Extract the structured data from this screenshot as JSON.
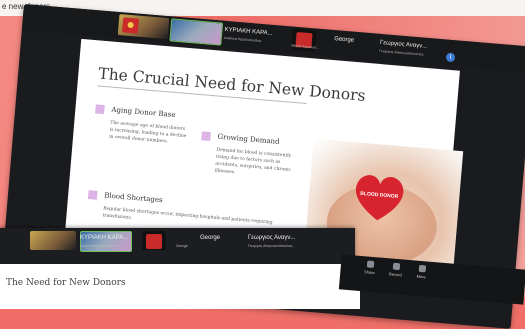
{
  "page_top_text": "e new donors.",
  "zoom": {
    "tiles": [
      {
        "name": "ΚΥΡΙΑΚΗ ΚΑΡΑ...",
        "sub": "Ιωνάννα Καραλοπούλου"
      },
      {
        "name": "George",
        "sub": "Μαρία Καραλοπ..."
      },
      {
        "name": "Γεωργιος Αναγν...",
        "sub": "Γεωργιος Αναγνωστόπουλος"
      }
    ],
    "info_icon": "i"
  },
  "slide": {
    "title": "The Crucial Need for New Donors",
    "sections": [
      {
        "heading": "Aging Donor Base",
        "body": "The average age of blood donors is increasing, leading to a decline in overall donor numbers."
      },
      {
        "heading": "Growing Demand",
        "body": "Demand for blood is consistently rising due to factors such as accidents, surgeries, and chronic illnesses."
      },
      {
        "heading": "Blood Shortages",
        "body": "Regular blood shortages occur, impacting hospitals and patients requiring transfusions."
      }
    ],
    "heart_label": "BLOOD DONOR",
    "heart_color": "#d8242e",
    "accent_square": "#dcb4e6"
  },
  "second_screen": {
    "tiles": [
      {
        "name": "ΚΥΡΙΑΚΗ ΚΑΡΑ...",
        "sub": "Ιωνάννα Καραλοπούλου"
      },
      {
        "name": "George",
        "sub": "George"
      },
      {
        "name": "Γεωργιος Αναγν...",
        "sub": "Γεωργιος Αναγνωστόπουλος"
      }
    ],
    "title": "The Need for New Donors"
  },
  "bottom_bar": {
    "items": [
      "Share",
      "Record",
      "More"
    ]
  }
}
